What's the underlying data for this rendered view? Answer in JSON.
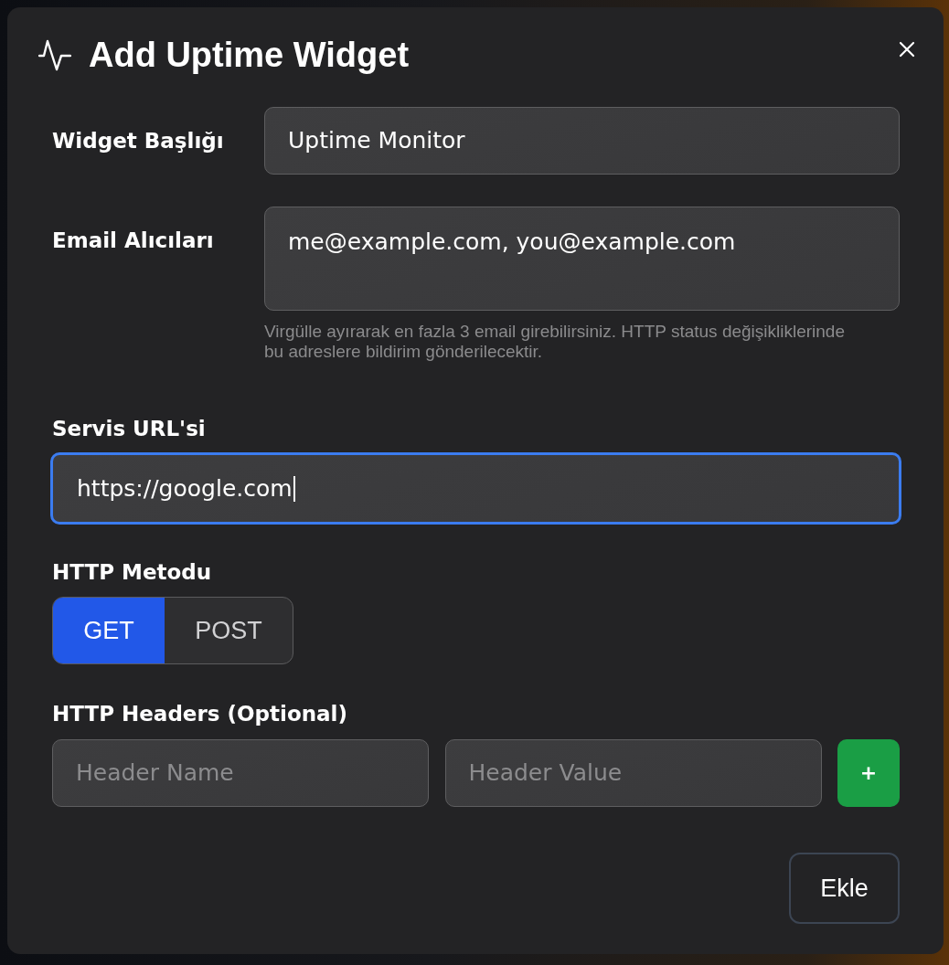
{
  "dialog": {
    "title": "Add Uptime Widget"
  },
  "inline_fields": [
    {
      "kind": "input",
      "label": "Widget Başlığı",
      "value": "Uptime Monitor",
      "focused": false
    },
    {
      "kind": "textarea",
      "label": "Email Alıcıları",
      "value": "me@example.com, you@example.com",
      "focused": false,
      "help": "Virgülle ayırarak en fazla 3 email girebilirsiniz. HTTP status değişikliklerinde bu adreslere bildirim gönderilecektir."
    }
  ],
  "url_field": {
    "label": "Servis URL'si",
    "value": "https://google.com",
    "focused": true
  },
  "method": {
    "label": "HTTP Metodu",
    "options": [
      {
        "label": "GET",
        "selected": true
      },
      {
        "label": "POST",
        "selected": false
      }
    ]
  },
  "headers": {
    "label": "HTTP Headers (Optional)",
    "fields": [
      {
        "placeholder": "Header Name"
      },
      {
        "placeholder": "Header Value"
      }
    ],
    "add_button": "+"
  },
  "submit_button": "Ekle"
}
